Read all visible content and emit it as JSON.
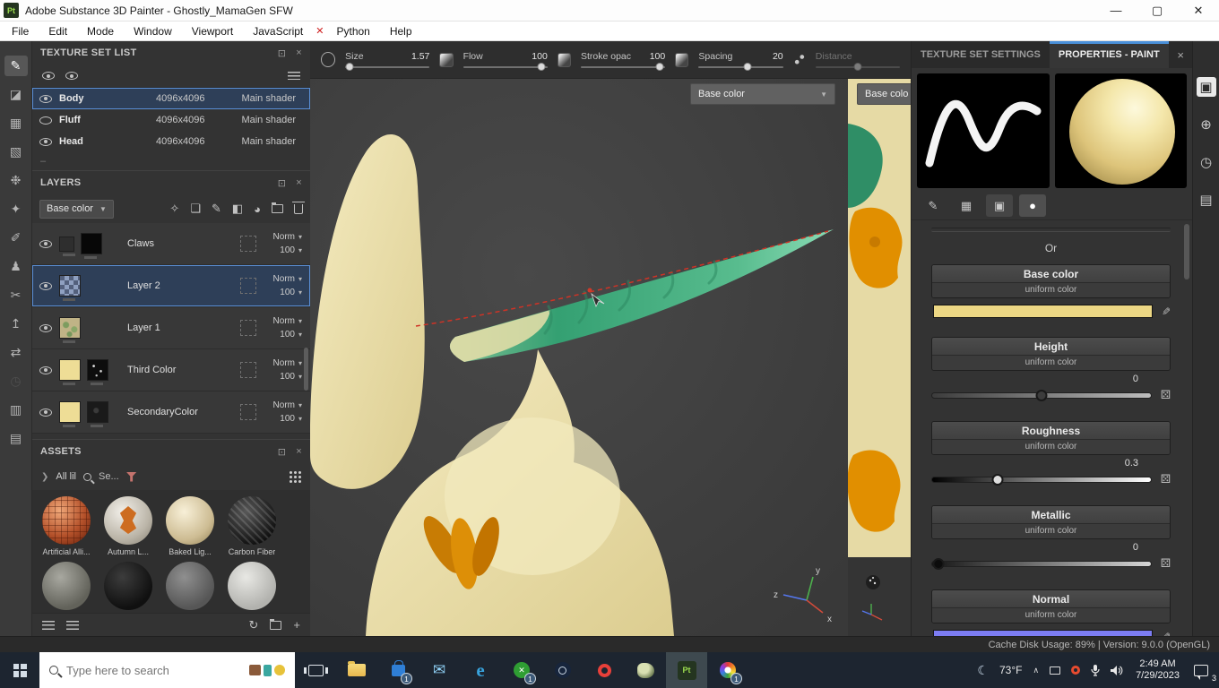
{
  "colors": {
    "accent_blue": "#4a90d9",
    "selection_blue": "#5a8fd6",
    "base_color_swatch": "#ecd784",
    "normal_swatch": "#7c7cf2",
    "horn_green": "#3fa87c",
    "creature_cream": "#ece1ad",
    "claw_orange": "#dd8f07"
  },
  "titlebar": {
    "app_badge": "Pt",
    "title": "Adobe Substance 3D Painter - Ghostly_MamaGen SFW"
  },
  "menubar": {
    "items": [
      {
        "label": "File"
      },
      {
        "label": "Edit"
      },
      {
        "label": "Mode"
      },
      {
        "label": "Window"
      },
      {
        "label": "Viewport"
      },
      {
        "label": "JavaScript"
      },
      {
        "label": "Python"
      },
      {
        "label": "Help"
      }
    ]
  },
  "texture_set_list": {
    "title": "TEXTURE SET LIST",
    "rows": [
      {
        "name": "Body",
        "resolution": "4096x4096",
        "shader": "Main shader"
      },
      {
        "name": "Fluff",
        "resolution": "4096x4096",
        "shader": "Main shader"
      },
      {
        "name": "Head",
        "resolution": "4096x4096",
        "shader": "Main shader"
      }
    ]
  },
  "layers_panel": {
    "title": "LAYERS",
    "channel_filter": "Base color",
    "rows": [
      {
        "name": "Claws",
        "blend": "Norm",
        "opacity": "100"
      },
      {
        "name": "Layer 2",
        "blend": "Norm",
        "opacity": "100"
      },
      {
        "name": "Layer 1",
        "blend": "Norm",
        "opacity": "100"
      },
      {
        "name": "Third Color",
        "blend": "Norm",
        "opacity": "100"
      },
      {
        "name": "SecondaryColor",
        "blend": "Norm",
        "opacity": "100"
      }
    ]
  },
  "assets_panel": {
    "title": "ASSETS",
    "scope_label": "All lil",
    "search_value": "Se...",
    "items": [
      {
        "label": "Artificial Alli..."
      },
      {
        "label": "Autumn L..."
      },
      {
        "label": "Baked Lig..."
      },
      {
        "label": "Carbon Fiber"
      }
    ]
  },
  "brush_toolbar": {
    "size": {
      "label": "Size",
      "value": "1.57"
    },
    "flow": {
      "label": "Flow",
      "value": "100"
    },
    "stroke_opacity": {
      "label": "Stroke opac",
      "value": "100"
    },
    "spacing": {
      "label": "Spacing",
      "value": "20"
    },
    "distance": {
      "label": "Distance"
    }
  },
  "viewport": {
    "channel_dropdown": "Base color",
    "channel_dropdown_2d": "Base colo",
    "axis_x": "x",
    "axis_y": "y",
    "axis_z": "z"
  },
  "properties_panel": {
    "tab_texture_set": "TEXTURE SET SETTINGS",
    "tab_properties": "PROPERTIES - PAINT",
    "or_label": "Or",
    "base_color": {
      "title": "Base color",
      "subtitle": "uniform color"
    },
    "height": {
      "title": "Height",
      "subtitle": "uniform color",
      "value": "0"
    },
    "roughness": {
      "title": "Roughness",
      "subtitle": "uniform color",
      "value": "0.3"
    },
    "metallic": {
      "title": "Metallic",
      "subtitle": "uniform color",
      "value": "0"
    },
    "normal": {
      "title": "Normal",
      "subtitle": "uniform color"
    }
  },
  "statusbar": {
    "text": "Cache Disk Usage: 89% | Version: 9.0.0 (OpenGL)"
  },
  "taskbar": {
    "search_placeholder": "Type here to search",
    "store_badge": "1",
    "xbox_badge": "1",
    "paint_badge": "1",
    "temperature": "73°F",
    "time": "2:49 AM",
    "date": "7/29/2023",
    "notification_count": "3"
  }
}
